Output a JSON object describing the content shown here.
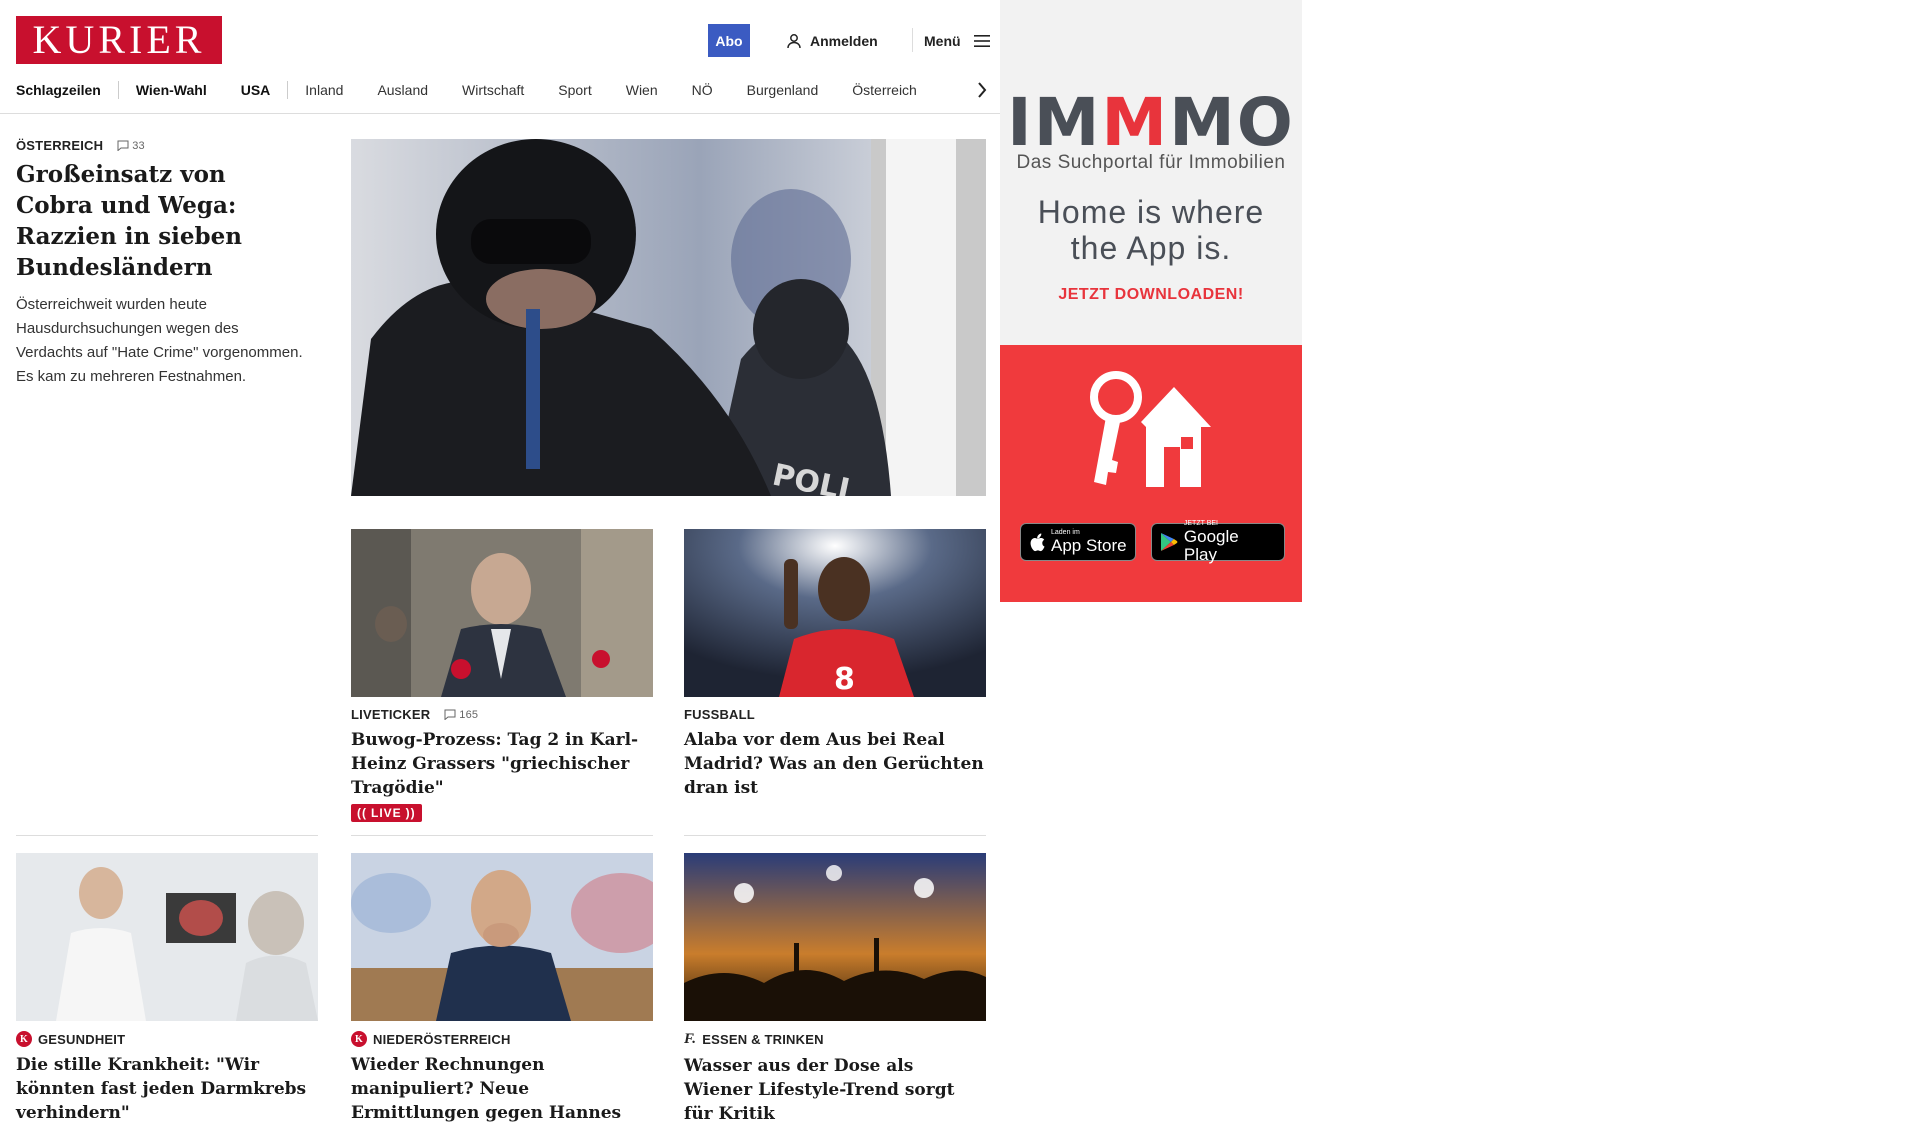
{
  "header": {
    "logo_text": "KURIER",
    "abo_label": "Abo",
    "login_label": "Anmelden",
    "menu_label": "Menü",
    "nav": [
      {
        "label": "Schlagzeilen",
        "bold": true
      },
      {
        "label": "Wien-Wahl",
        "bold": true
      },
      {
        "label": "USA",
        "bold": true
      },
      {
        "label": "Inland",
        "bold": false
      },
      {
        "label": "Ausland",
        "bold": false
      },
      {
        "label": "Wirtschaft",
        "bold": false
      },
      {
        "label": "Sport",
        "bold": false
      },
      {
        "label": "Wien",
        "bold": false
      },
      {
        "label": "NÖ",
        "bold": false
      },
      {
        "label": "Burgenland",
        "bold": false
      },
      {
        "label": "Österreich",
        "bold": false
      }
    ]
  },
  "lead": {
    "kicker": "ÖSTERREICH",
    "comments": "33",
    "title": "Großeinsatz von Cobra und Wega: Razzien in sieben Bundesländern",
    "teaser": "Österreichweit wurden heute Hausdurchsuchungen wegen des Verdachts auf \"Hate Crime\" vorgenommen. Es kam zu mehreren Festnahmen.",
    "image_text": "POLI"
  },
  "cards": [
    {
      "kicker": "LIVETICKER",
      "comments": "165",
      "title": "Buwog-Prozess: Tag 2 in Karl-Heinz Grassers \"griechischer Tragödie\"",
      "live": "LIVE"
    },
    {
      "kicker": "FUSSBALL",
      "title": "Alaba vor dem Aus bei Real Madrid? Was an den Gerüchten dran ist"
    },
    {
      "kicker": "GESUNDHEIT",
      "icon": "K",
      "title": "Die stille Krankheit: \"Wir könnten fast jeden Darmkrebs verhindern\""
    },
    {
      "kicker": "NIEDERÖSTERREICH",
      "icon": "K",
      "title": "Wieder Rechnungen manipuliert? Neue Ermittlungen gegen Hannes"
    },
    {
      "kicker": "ESSEN & TRINKEN",
      "icon": "f.",
      "title": "Wasser aus der Dose als Wiener Lifestyle-Trend sorgt für Kritik"
    }
  ],
  "ad": {
    "logo_parts": [
      "IM",
      "M",
      "MO"
    ],
    "subtitle": "Das Suchportal für Immobilien",
    "headline_1": "Home is where",
    "headline_2": "the App is.",
    "cta": "JETZT DOWNLOADEN!",
    "appstore_small": "Laden im",
    "appstore_big": "App Store",
    "googleplay_small": "JETZT BEI",
    "googleplay_big": "Google Play"
  },
  "colors": {
    "brand_red": "#c8102e",
    "abo_blue": "#3b5bc2",
    "ad_red": "#f03a3d",
    "ad_grey": "#4a4f57"
  }
}
